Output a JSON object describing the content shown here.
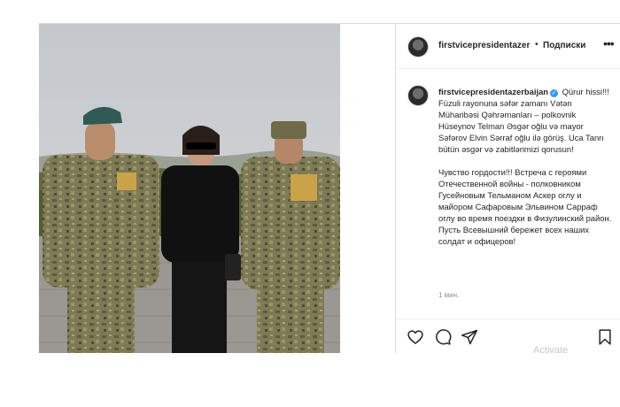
{
  "post": {
    "username": "firstvicepresidentazer",
    "dot": "•",
    "follow_label": "Подписки",
    "more_icon": "more-horizontal-icon",
    "caption": {
      "username": "firstvicepresidentazerbaijan",
      "verified_icon": "verified-badge-icon",
      "text_az": "Qürur hissi!!! Füzuli rayonuna səfər zamanı Vətən Müharibəsi Qəhrəmanları – polkovnik Hüseynov Telman Əsgər oğlu və mayor Səfərov Elvin Sərraf oğlu ilə görüş. Uca Tanrı bütün əsgər və zabitlərimizi qorusun!",
      "text_ru": "Чувство гордости!!! Встреча с героями Отечественной войны - полковником Гусейновым Тельманом Аскер оглу и майором Сафаровым Эльвином Сарраф оглу во время поездки в Физулинский район. Пусть Всевышний бережет всех наших солдат и офицеров!"
    },
    "timestamp": "1 мин.",
    "actions": {
      "like_icon": "heart-icon",
      "comment_icon": "comment-icon",
      "share_icon": "share-icon",
      "save_icon": "bookmark-icon"
    }
  },
  "watermark": "Activate",
  "colors": {
    "verified": "#3897f0",
    "text": "#262626",
    "muted": "#8e8e8e",
    "border": "#dbdbdb"
  }
}
